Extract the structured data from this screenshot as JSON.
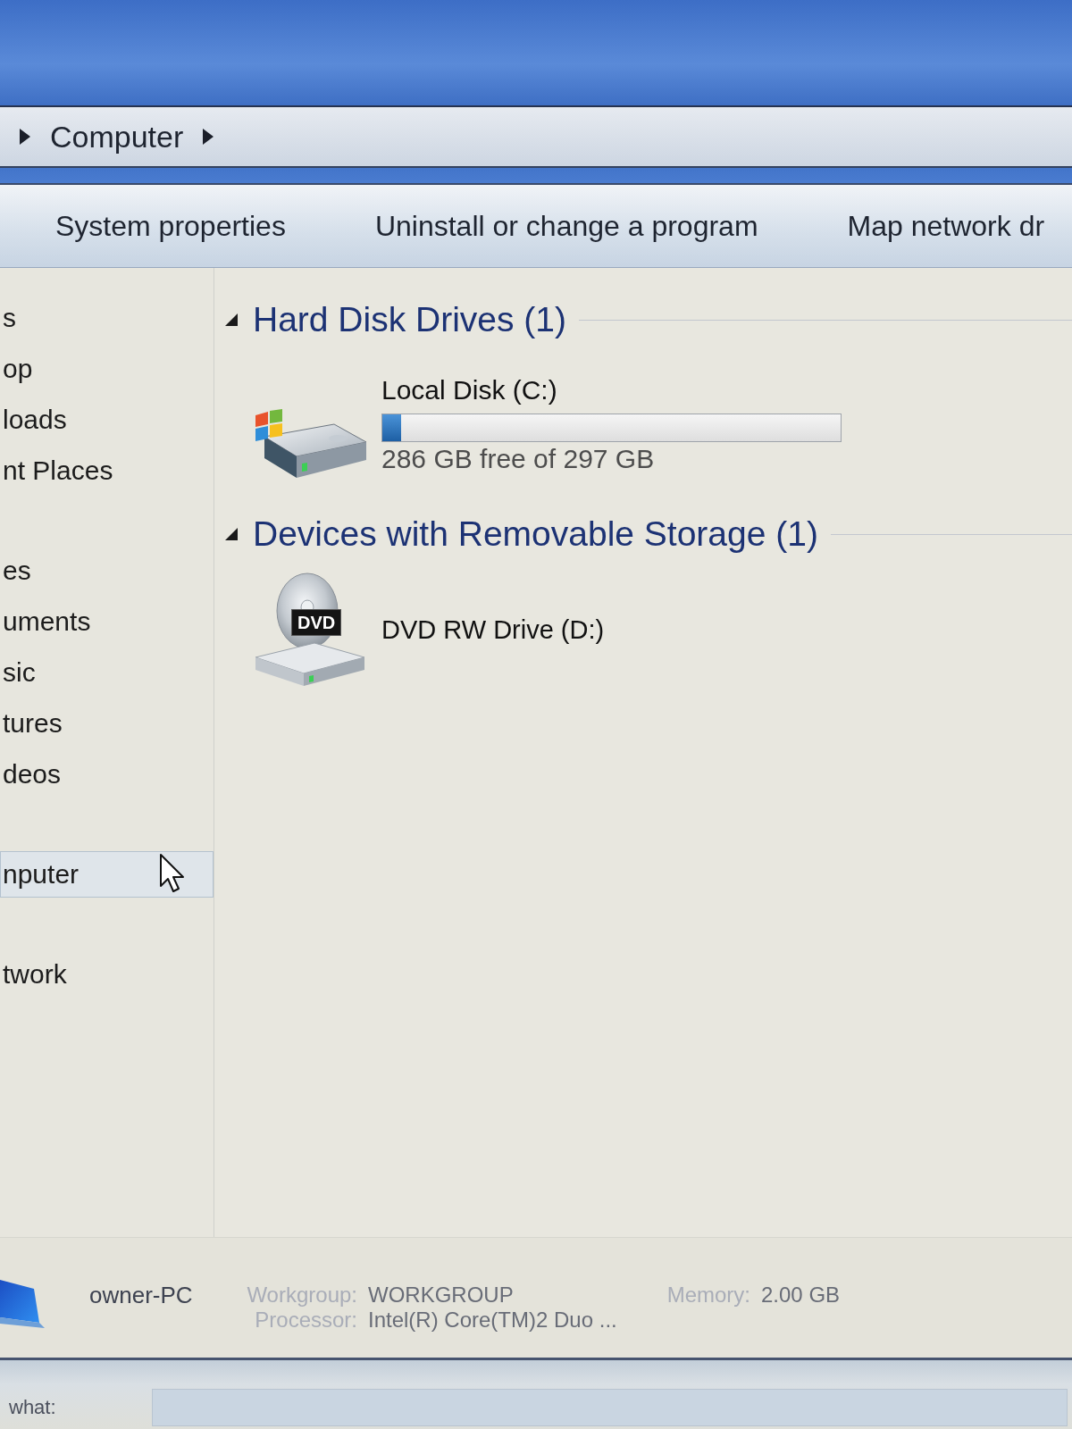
{
  "address_bar": {
    "crumbs": [
      {
        "label": "Computer"
      }
    ]
  },
  "toolbar": {
    "buttons": [
      {
        "label": "System properties"
      },
      {
        "label": "Uninstall or change a program"
      },
      {
        "label": "Map network dr"
      }
    ]
  },
  "navigation_pane": {
    "items": [
      {
        "label": "s",
        "selected": false,
        "children": [
          {
            "label": "op",
            "selected": false
          },
          {
            "label": "loads",
            "selected": false
          },
          {
            "label": "nt Places",
            "selected": false
          }
        ]
      },
      {
        "label": "es",
        "selected": false,
        "children": [
          {
            "label": "uments",
            "selected": false
          },
          {
            "label": "sic",
            "selected": false
          },
          {
            "label": "tures",
            "selected": false
          },
          {
            "label": "deos",
            "selected": false
          }
        ]
      },
      {
        "label": "nputer",
        "selected": true
      },
      {
        "label": "twork",
        "selected": false
      }
    ]
  },
  "groups": [
    {
      "title": "Hard Disk Drives (1)",
      "expanded": true,
      "items": [
        {
          "kind": "disk",
          "name": "Local Disk (C:)",
          "level": 0.04,
          "reading": "286 GB free of 297 GB"
        }
      ]
    },
    {
      "title": "Devices with Removable Storage (1)",
      "expanded": true,
      "items": [
        {
          "kind": "optical",
          "name": "DVD RW Drive (D:)",
          "icon_label": "DVD"
        }
      ]
    }
  ],
  "details_pane": {
    "computer_name": "owner-PC",
    "fields": [
      {
        "label": "Workgroup:",
        "value": "WORKGROUP"
      },
      {
        "label": "Memory:",
        "value": "2.00 GB"
      },
      {
        "label": "Processor:",
        "value": "Intel(R) Core(TM)2 Duo ..."
      }
    ]
  },
  "bottom_bar": {
    "label": "what:"
  }
}
